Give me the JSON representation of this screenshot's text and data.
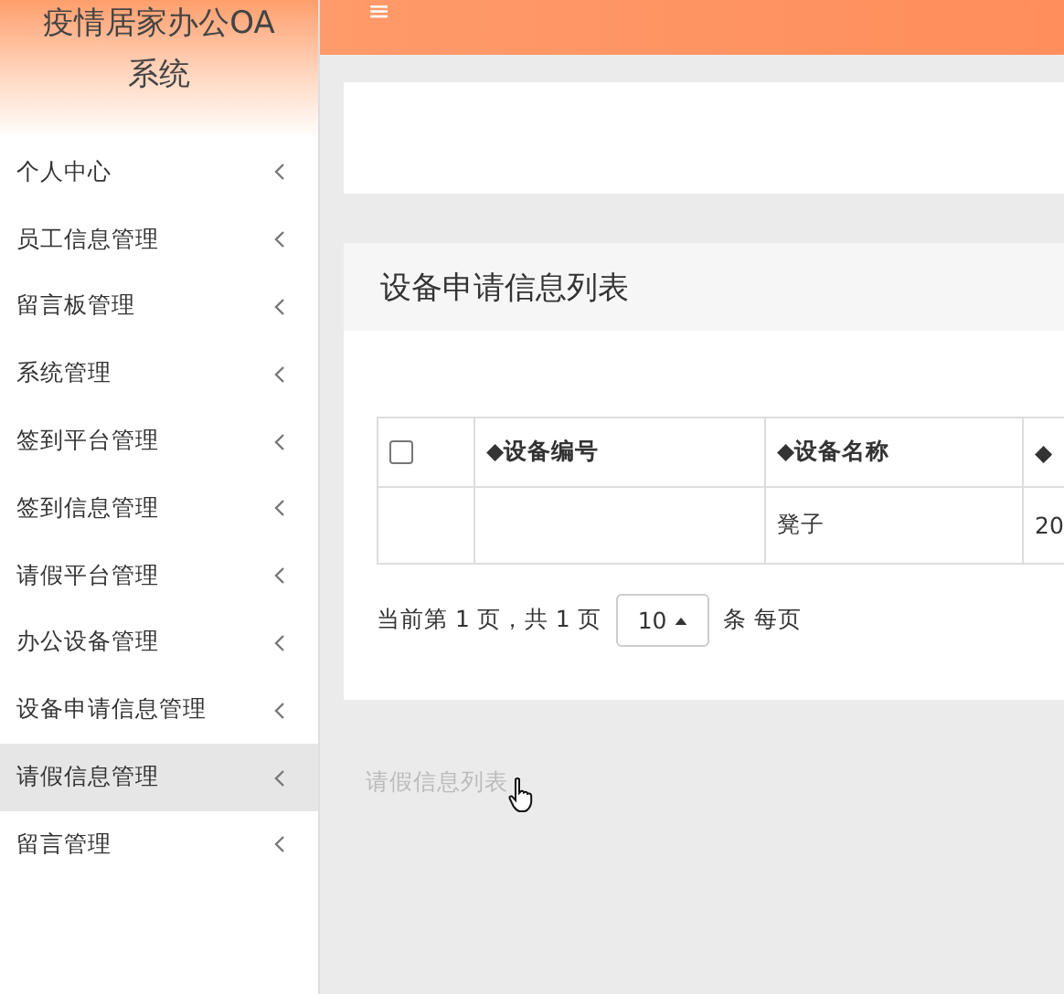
{
  "sidebar": {
    "title": "疫情居家办公OA系统",
    "items": [
      {
        "label": "个人中心",
        "selected": false
      },
      {
        "label": "员工信息管理",
        "selected": false
      },
      {
        "label": "留言板管理",
        "selected": false
      },
      {
        "label": "系统管理",
        "selected": false
      },
      {
        "label": "签到平台管理",
        "selected": false
      },
      {
        "label": "签到信息管理",
        "selected": false
      },
      {
        "label": "请假平台管理",
        "selected": false
      },
      {
        "label": "办公设备管理",
        "selected": false
      },
      {
        "label": "设备申请信息管理",
        "selected": false
      },
      {
        "label": "请假信息管理",
        "selected": true
      },
      {
        "label": "留言管理",
        "selected": false
      }
    ]
  },
  "topbar": {
    "menu_icon": "≡"
  },
  "panel": {
    "title": "设备申请信息列表",
    "table": {
      "select_all": {
        "checked": false
      },
      "columns": [
        "◆设备编号",
        "◆设备名称",
        "◆"
      ],
      "rows": [
        [
          "",
          "凳子",
          "20"
        ]
      ]
    },
    "pagination": {
      "summary": "当前第 1 页，共 1 页",
      "page_size": "10",
      "suffix": "条 每页"
    }
  },
  "submenu_hint": "请假信息列表"
}
